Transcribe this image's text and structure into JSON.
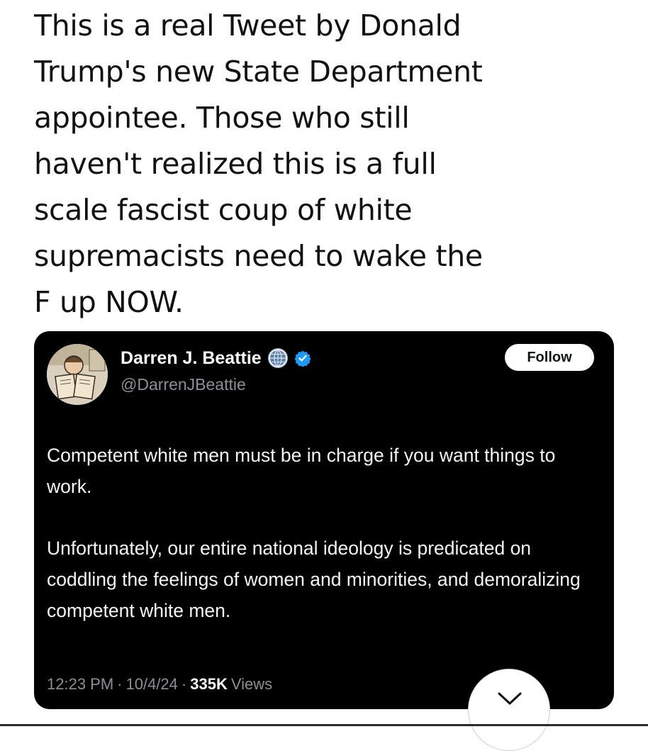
{
  "headline": {
    "lines": [
      "This is a real Tweet by Donald",
      "Trump's new State Department",
      "appointee. Those who still",
      "haven't realized this is a full",
      "scale fascist coup of white",
      "supremacists need to wake the",
      "F up NOW."
    ]
  },
  "tweet": {
    "display_name": "Darren J. Beattie",
    "handle": "@DarrenJBeattie",
    "follow_label": "Follow",
    "icons": [
      "globe-icon",
      "verified-icon"
    ],
    "paragraphs": [
      "Competent white men must be in charge if you want things to work.",
      "Unfortunately, our entire national ideology is predicated on coddling the feelings of women and minorities, and demoralizing competent white men."
    ],
    "time": "12:23 PM",
    "date": "10/4/24",
    "separator": "·",
    "views_count": "335K",
    "views_label": "Views"
  },
  "colors": {
    "card_background": "#000000",
    "muted_text": "#8b8f94",
    "verified_blue": "#1d9bf0"
  }
}
